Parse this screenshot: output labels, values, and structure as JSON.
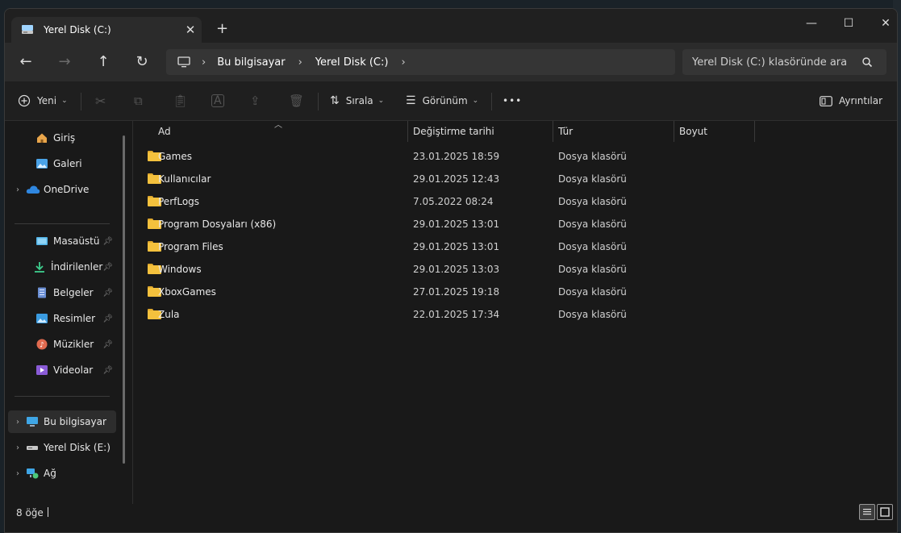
{
  "window": {
    "tab_title": "Yerel Disk (C:)",
    "new_tab": "+",
    "controls": {
      "minimize": "—",
      "maximize": "☐",
      "close": "✕"
    }
  },
  "nav": {
    "back": "←",
    "forward": "→",
    "up": "↑",
    "refresh": "↻",
    "breadcrumb": [
      "Bu bilgisayar",
      "Yerel Disk (C:)"
    ],
    "search_placeholder": "Yerel Disk (C:) klasöründe ara"
  },
  "toolbar": {
    "new_label": "Yeni",
    "sort_label": "Sırala",
    "view_label": "Görünüm",
    "more": "•••",
    "details_label": "Ayrıntılar"
  },
  "sidebar": {
    "items": [
      {
        "label": "Giriş",
        "icon": "home-icon"
      },
      {
        "label": "Galeri",
        "icon": "gallery-icon"
      },
      {
        "label": "OneDrive",
        "icon": "cloud-icon"
      },
      {
        "label": "Masaüstü",
        "icon": "desktop-icon"
      },
      {
        "label": "İndirilenler",
        "icon": "download-icon"
      },
      {
        "label": "Belgeler",
        "icon": "document-icon"
      },
      {
        "label": "Resimler",
        "icon": "pictures-icon"
      },
      {
        "label": "Müzikler",
        "icon": "music-icon"
      },
      {
        "label": "Videolar",
        "icon": "video-icon"
      },
      {
        "label": "Bu bilgisayar",
        "icon": "computer-icon"
      },
      {
        "label": "Yerel Disk (E:)",
        "icon": "drive-icon"
      },
      {
        "label": "Ağ",
        "icon": "network-icon"
      }
    ]
  },
  "columns": {
    "name": "Ad",
    "date": "Değiştirme tarihi",
    "type": "Tür",
    "size": "Boyut"
  },
  "files": [
    {
      "name": "Games",
      "date": "23.01.2025 18:59",
      "type": "Dosya klasörü"
    },
    {
      "name": "Kullanıcılar",
      "date": "29.01.2025 12:43",
      "type": "Dosya klasörü"
    },
    {
      "name": "PerfLogs",
      "date": "7.05.2022 08:24",
      "type": "Dosya klasörü"
    },
    {
      "name": "Program Dosyaları (x86)",
      "date": "29.01.2025 13:01",
      "type": "Dosya klasörü"
    },
    {
      "name": "Program Files",
      "date": "29.01.2025 13:01",
      "type": "Dosya klasörü"
    },
    {
      "name": "Windows",
      "date": "29.01.2025 13:03",
      "type": "Dosya klasörü"
    },
    {
      "name": "XboxGames",
      "date": "27.01.2025 19:18",
      "type": "Dosya klasörü"
    },
    {
      "name": "Zula",
      "date": "22.01.2025 17:34",
      "type": "Dosya klasörü"
    }
  ],
  "status": {
    "count": "8 öğe"
  },
  "colors": {
    "folder": "#f4c13d",
    "accent": "#4cc2ff"
  }
}
